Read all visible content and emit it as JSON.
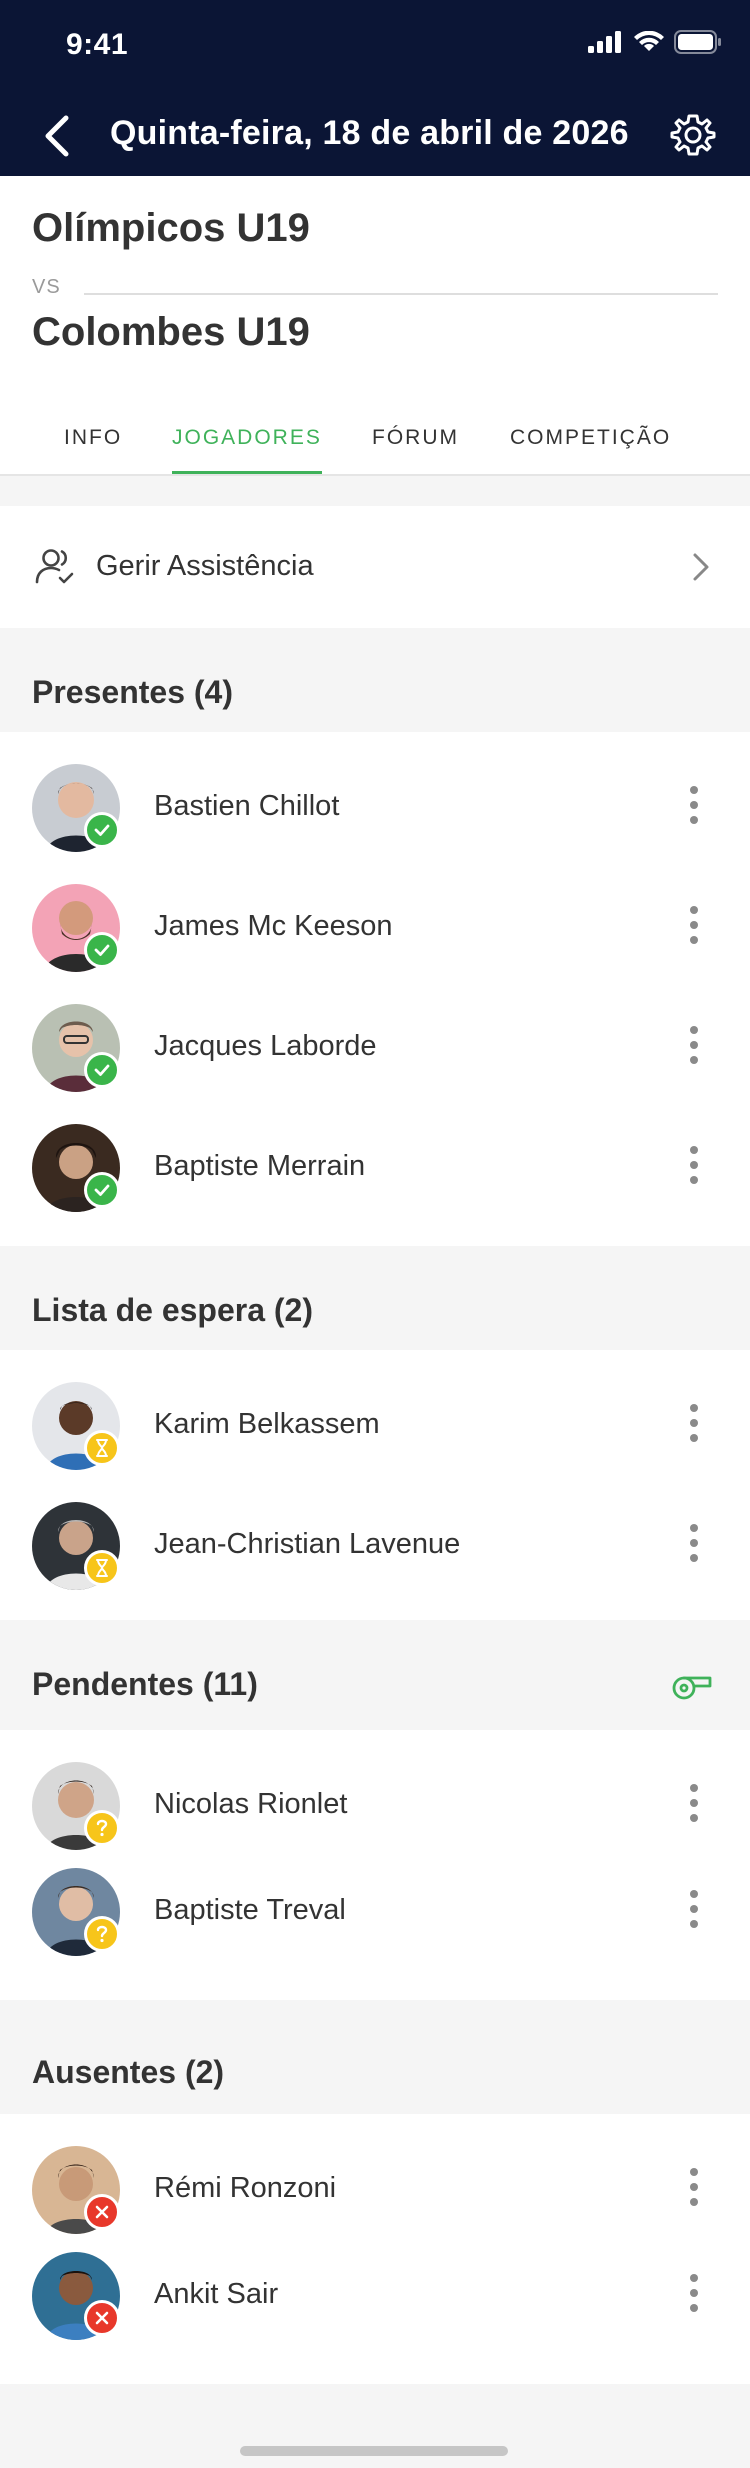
{
  "status_bar": {
    "time": "9:41"
  },
  "nav": {
    "title": "Quinta-feira, 18 de abril de 2026"
  },
  "match": {
    "home_team": "Olímpicos U19",
    "vs": "VS",
    "away_team": "Colombes U19"
  },
  "tabs": [
    {
      "label": "INFO",
      "active": false
    },
    {
      "label": "JOGADORES",
      "active": true
    },
    {
      "label": "FÓRUM",
      "active": false
    },
    {
      "label": "COMPETIÇÃO",
      "active": false
    }
  ],
  "manage_attendance": {
    "label": "Gerir Assistência"
  },
  "sections": {
    "present": {
      "title": "Presentes (4)",
      "players": [
        {
          "name": "Bastien Chillot"
        },
        {
          "name": "James Mc Keeson"
        },
        {
          "name": "Jacques Laborde"
        },
        {
          "name": "Baptiste Merrain"
        }
      ]
    },
    "waitlist": {
      "title": "Lista de espera (2)",
      "players": [
        {
          "name": "Karim Belkassem"
        },
        {
          "name": "Jean-Christian Lavenue"
        }
      ]
    },
    "pending": {
      "title": "Pendentes (11)",
      "players": [
        {
          "name": "Nicolas Rionlet"
        },
        {
          "name": "Baptiste Treval"
        }
      ]
    },
    "absent": {
      "title": "Ausentes (2)",
      "players": [
        {
          "name": "Rémi Ronzoni"
        },
        {
          "name": "Ankit Sair"
        }
      ]
    }
  },
  "colors": {
    "header_bg": "#0b1535",
    "accent_green": "#3fb25a",
    "present_badge": "#3ab54a",
    "waiting_badge": "#f7c51a",
    "absent_badge": "#e8382b"
  }
}
